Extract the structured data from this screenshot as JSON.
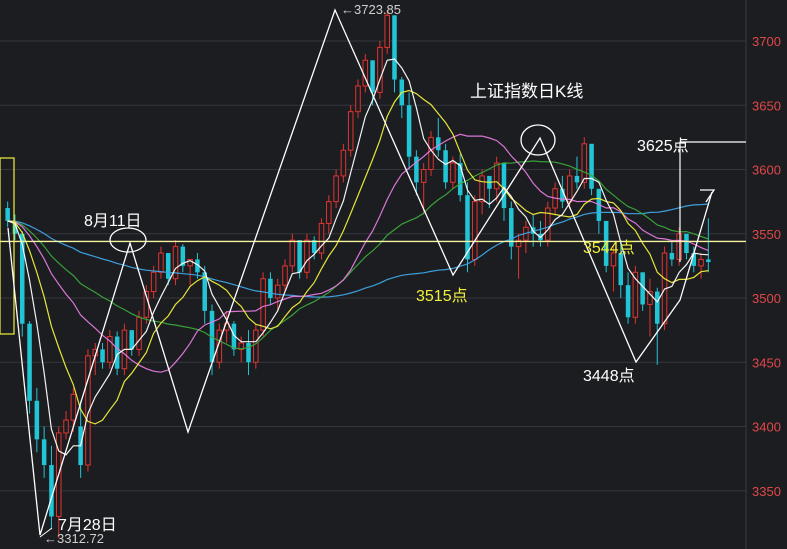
{
  "chart_data": {
    "type": "candlestick",
    "title": "上证指数日K线",
    "y_axis": {
      "ticks": [
        3350,
        3400,
        3450,
        3500,
        3550,
        3600,
        3650,
        3700
      ],
      "labels": [
        "3350",
        "3400",
        "3450",
        "3500",
        "3550",
        "3600",
        "3650",
        "3700"
      ],
      "ylim": [
        3300,
        3730
      ],
      "grid": true,
      "side": "right"
    },
    "candles": [
      [
        3570,
        3575,
        3555,
        3560
      ],
      [
        3560,
        3565,
        3545,
        3550
      ],
      [
        3550,
        3552,
        3470,
        3480
      ],
      [
        3480,
        3482,
        3410,
        3420
      ],
      [
        3420,
        3430,
        3380,
        3390
      ],
      [
        3390,
        3400,
        3360,
        3370
      ],
      [
        3370,
        3385,
        3320,
        3330
      ],
      [
        3330,
        3400,
        3313,
        3395
      ],
      [
        3395,
        3412,
        3390,
        3405
      ],
      [
        3405,
        3430,
        3396,
        3425
      ],
      [
        3400,
        3420,
        3360,
        3370
      ],
      [
        3370,
        3460,
        3365,
        3455
      ],
      [
        3455,
        3465,
        3440,
        3460
      ],
      [
        3460,
        3465,
        3445,
        3450
      ],
      [
        3450,
        3475,
        3445,
        3470
      ],
      [
        3470,
        3474,
        3440,
        3445
      ],
      [
        3445,
        3480,
        3440,
        3475
      ],
      [
        3475,
        3472,
        3455,
        3460
      ],
      [
        3460,
        3490,
        3455,
        3485
      ],
      [
        3485,
        3510,
        3480,
        3505
      ],
      [
        3505,
        3525,
        3500,
        3520
      ],
      [
        3520,
        3540,
        3515,
        3535
      ],
      [
        3535,
        3530,
        3510,
        3515
      ],
      [
        3515,
        3545,
        3510,
        3540
      ],
      [
        3540,
        3542,
        3520,
        3525
      ],
      [
        3525,
        3530,
        3510,
        3530
      ],
      [
        3530,
        3535,
        3515,
        3520
      ],
      [
        3520,
        3525,
        3480,
        3490
      ],
      [
        3490,
        3495,
        3440,
        3450
      ],
      [
        3450,
        3480,
        3445,
        3475
      ],
      [
        3475,
        3490,
        3465,
        3480
      ],
      [
        3480,
        3482,
        3455,
        3460
      ],
      [
        3460,
        3470,
        3450,
        3465
      ],
      [
        3465,
        3475,
        3440,
        3450
      ],
      [
        3450,
        3480,
        3445,
        3475
      ],
      [
        3475,
        3520,
        3470,
        3515
      ],
      [
        3515,
        3520,
        3495,
        3500
      ],
      [
        3500,
        3515,
        3490,
        3510
      ],
      [
        3510,
        3530,
        3505,
        3525
      ],
      [
        3525,
        3550,
        3520,
        3545
      ],
      [
        3545,
        3540,
        3515,
        3520
      ],
      [
        3520,
        3550,
        3515,
        3545
      ],
      [
        3545,
        3548,
        3530,
        3535
      ],
      [
        3535,
        3562,
        3530,
        3558
      ],
      [
        3558,
        3580,
        3550,
        3575
      ],
      [
        3575,
        3600,
        3570,
        3595
      ],
      [
        3595,
        3620,
        3590,
        3615
      ],
      [
        3615,
        3650,
        3610,
        3645
      ],
      [
        3645,
        3670,
        3640,
        3665
      ],
      [
        3665,
        3690,
        3660,
        3685
      ],
      [
        3685,
        3680,
        3650,
        3660
      ],
      [
        3660,
        3700,
        3655,
        3695
      ],
      [
        3695,
        3724,
        3690,
        3720
      ],
      [
        3720,
        3715,
        3660,
        3670
      ],
      [
        3670,
        3672,
        3640,
        3650
      ],
      [
        3650,
        3660,
        3600,
        3610
      ],
      [
        3610,
        3615,
        3580,
        3590
      ],
      [
        3590,
        3605,
        3565,
        3600
      ],
      [
        3600,
        3630,
        3595,
        3625
      ],
      [
        3625,
        3640,
        3610,
        3615
      ],
      [
        3615,
        3620,
        3585,
        3590
      ],
      [
        3590,
        3610,
        3585,
        3605
      ],
      [
        3605,
        3612,
        3575,
        3580
      ],
      [
        3580,
        3590,
        3520,
        3530
      ],
      [
        3530,
        3580,
        3525,
        3575
      ],
      [
        3575,
        3600,
        3565,
        3595
      ],
      [
        3595,
        3590,
        3570,
        3585
      ],
      [
        3585,
        3610,
        3575,
        3605
      ],
      [
        3605,
        3600,
        3560,
        3570
      ],
      [
        3570,
        3575,
        3530,
        3540
      ],
      [
        3540,
        3550,
        3515,
        3545
      ],
      [
        3545,
        3560,
        3535,
        3555
      ],
      [
        3555,
        3565,
        3540,
        3550
      ],
      [
        3550,
        3560,
        3540,
        3545
      ],
      [
        3545,
        3575,
        3540,
        3570
      ],
      [
        3570,
        3590,
        3565,
        3585
      ],
      [
        3585,
        3595,
        3570,
        3575
      ],
      [
        3575,
        3600,
        3570,
        3595
      ],
      [
        3595,
        3610,
        3585,
        3590
      ],
      [
        3590,
        3625,
        3585,
        3620
      ],
      [
        3620,
        3615,
        3580,
        3585
      ],
      [
        3585,
        3580,
        3550,
        3560
      ],
      [
        3560,
        3555,
        3520,
        3525
      ],
      [
        3525,
        3540,
        3505,
        3535
      ],
      [
        3535,
        3545,
        3500,
        3510
      ],
      [
        3510,
        3520,
        3480,
        3485
      ],
      [
        3485,
        3525,
        3480,
        3520
      ],
      [
        3520,
        3510,
        3490,
        3495
      ],
      [
        3495,
        3515,
        3470,
        3505
      ],
      [
        3505,
        3508,
        3448,
        3480
      ],
      [
        3480,
        3540,
        3475,
        3535
      ],
      [
        3535,
        3545,
        3525,
        3530
      ],
      [
        3530,
        3555,
        3525,
        3550
      ],
      [
        3550,
        3548,
        3530,
        3535
      ],
      [
        3535,
        3540,
        3520,
        3525
      ],
      [
        3525,
        3535,
        3515,
        3530
      ],
      [
        3530,
        3562,
        3520,
        3528
      ]
    ],
    "annotations": [
      {
        "text": "3723.85",
        "kind": "high_marker"
      },
      {
        "text": "3312.72",
        "kind": "low_marker"
      },
      {
        "text": "8月11日"
      },
      {
        "text": "7月28日"
      },
      {
        "text": "3515点"
      },
      {
        "text": "3544点"
      },
      {
        "text": "3448点"
      },
      {
        "text": "3625点"
      }
    ],
    "horizontal_line": {
      "value": 3544,
      "color": "#f5f5a0"
    },
    "colors": {
      "background": "#1c1d21",
      "up": "#e0342f",
      "down": "#22c5d6",
      "grid": "#34363c",
      "axis_text": "#e04848",
      "ma5": "#ffffff",
      "ma10": "#f2f03a",
      "ma20": "#e67be0",
      "ma30": "#3aa83a",
      "ma60": "#3fa7e8",
      "annotation_white": "#ffffff",
      "annotation_yellow": "#f2f03a"
    }
  }
}
